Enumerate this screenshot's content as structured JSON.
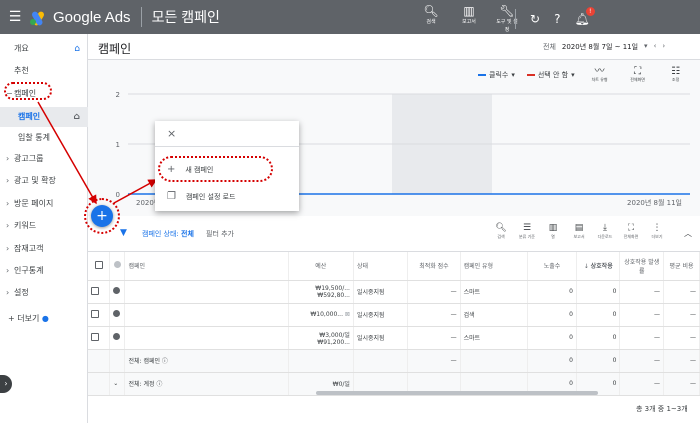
{
  "topbar": {
    "app_name": "Google Ads",
    "section": "모든 캠페인",
    "tools": [
      {
        "icon": "search-icon",
        "label": "검색"
      },
      {
        "icon": "reports-icon",
        "label": "보고서"
      },
      {
        "icon": "tools-icon",
        "label": "도구 및 설정"
      }
    ]
  },
  "sidebar": {
    "items": [
      {
        "label": "개요"
      },
      {
        "label": "추천"
      },
      {
        "label": "캠페인"
      },
      {
        "label": "캠페인"
      },
      {
        "label": "입찰 통계"
      },
      {
        "label": "광고그룹"
      },
      {
        "label": "광고 및 확장"
      },
      {
        "label": "방문 페이지"
      },
      {
        "label": "키워드"
      },
      {
        "label": "잠재고객"
      },
      {
        "label": "인구통계"
      },
      {
        "label": "설정"
      },
      {
        "label": "더보기"
      }
    ]
  },
  "header": {
    "title": "캠페인",
    "date_prefix": "전체",
    "date_range": "2020년 8월 7일 ~ 11일"
  },
  "chart": {
    "metrics": [
      {
        "label": "클릭수",
        "color": "#1a73e8"
      },
      {
        "label": "선택 안 함",
        "color": "#d93025"
      }
    ],
    "icons": [
      {
        "icon": "trend-icon",
        "label": "차트 유형"
      },
      {
        "icon": "expand-icon",
        "label": "전체화면"
      },
      {
        "icon": "adjust-icon",
        "label": "조정"
      }
    ]
  },
  "chart_data": {
    "type": "line",
    "x_labels": [
      "2020년",
      "2020년 8월 11일"
    ],
    "y_ticks": [
      "2",
      "1",
      "0"
    ],
    "series": [
      {
        "name": "클릭수",
        "values": [
          0,
          0
        ]
      }
    ],
    "ylim": [
      0,
      2
    ]
  },
  "popup": {
    "close": "×",
    "new_campaign": "새 캠페인",
    "load_settings": "캠페인 설정 로드"
  },
  "filter": {
    "status_label": "캠페인 상태:",
    "status_value": "전체",
    "add": "필터 추가"
  },
  "table_tools": [
    {
      "icon": "search-icon",
      "label": "검색"
    },
    {
      "icon": "segment-icon",
      "label": "분류 기준"
    },
    {
      "icon": "columns-icon",
      "label": "열"
    },
    {
      "icon": "chart-icon",
      "label": "보고서"
    },
    {
      "icon": "download-icon",
      "label": "다운로드"
    },
    {
      "icon": "fullscreen-icon",
      "label": "전체화면"
    },
    {
      "icon": "more-icon",
      "label": "더보기"
    }
  ],
  "table": {
    "headers": [
      "캠페인",
      "예산",
      "상태",
      "최적화 점수",
      "캠페인 유형",
      "노출수",
      "상호작용",
      "상호작용 발생률",
      "평균 비용"
    ],
    "rows": [
      {
        "budget": "₩19,500/...",
        "budget2": "₩592,80...",
        "status": "일시중지됨",
        "score": "—",
        "type": "스마트",
        "impr": "0",
        "inter": "0",
        "rate": "—",
        "cost": "—"
      },
      {
        "budget": "₩10,000...",
        "budget2": "",
        "status": "일시중지됨",
        "score": "—",
        "type": "검색",
        "impr": "0",
        "inter": "0",
        "rate": "—",
        "cost": "—"
      },
      {
        "budget": "₩3,000/일",
        "budget2": "₩91,200...",
        "status": "일시중지됨",
        "score": "—",
        "type": "스마트",
        "impr": "0",
        "inter": "0",
        "rate": "—",
        "cost": "—"
      }
    ],
    "total_campaign": {
      "label": "전체: 캠페인",
      "score": "—",
      "impr": "0",
      "inter": "0",
      "rate": "—",
      "cost": "—"
    },
    "total_account": {
      "label": "전체: 계정",
      "budget": "₩0/일",
      "impr": "0",
      "inter": "0",
      "rate": "—",
      "cost": "—"
    }
  },
  "footer": {
    "count": "총 3개 중 1~3개"
  }
}
